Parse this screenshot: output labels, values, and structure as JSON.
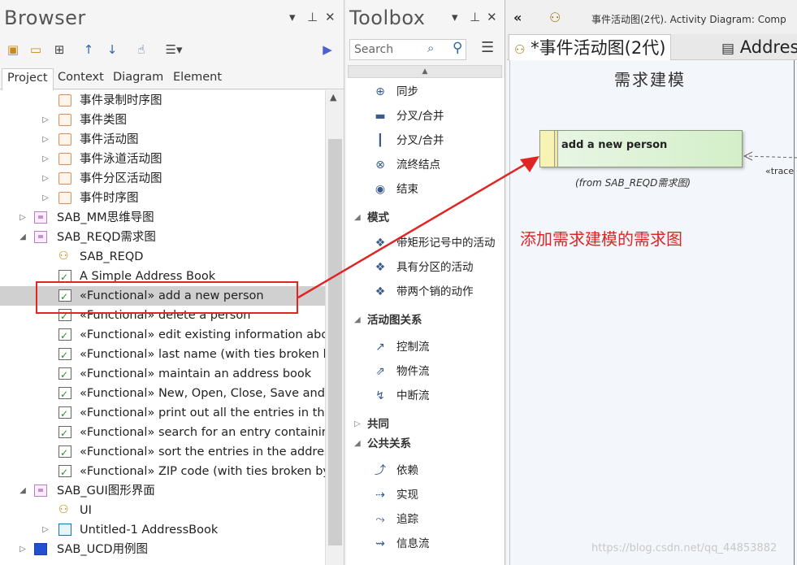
{
  "browser": {
    "title": "Browser",
    "tabs": [
      "Project",
      "Context",
      "Diagram",
      "Element"
    ],
    "tree": [
      {
        "label": "事件录制时序图",
        "icon": "folder-icon",
        "expander": ""
      },
      {
        "label": "事件类图",
        "icon": "folder-icon",
        "expander": "▷"
      },
      {
        "label": "事件活动图",
        "icon": "folder-icon",
        "expander": "▷"
      },
      {
        "label": "事件泳道活动图",
        "icon": "folder-icon",
        "expander": "▷"
      },
      {
        "label": "事件分区活动图",
        "icon": "folder-icon",
        "expander": "▷"
      },
      {
        "label": "事件时序图",
        "icon": "folder-icon",
        "expander": "▷"
      },
      {
        "label": "SAB_MM思维导图",
        "icon": "package-icon",
        "expander": "▷"
      },
      {
        "label": "SAB_REQD需求图",
        "icon": "package-icon",
        "expander": "◢"
      },
      {
        "label": "SAB_REQD",
        "icon": "hierarchy-icon",
        "expander": ""
      },
      {
        "label": "A Simple Address Book",
        "icon": "requirement-icon",
        "expander": ""
      },
      {
        "label": "«Functional» add a new person",
        "icon": "requirement-icon",
        "expander": ""
      },
      {
        "label": "«Functional» delete a person",
        "icon": "requirement-icon",
        "expander": ""
      },
      {
        "label": "«Functional» edit existing information abo",
        "icon": "requirement-icon",
        "expander": ""
      },
      {
        "label": "«Functional» last name (with ties broken b",
        "icon": "requirement-icon",
        "expander": ""
      },
      {
        "label": "«Functional» maintain an address book",
        "icon": "requirement-icon",
        "expander": ""
      },
      {
        "label": "«Functional» New, Open, Close, Save and",
        "icon": "requirement-icon",
        "expander": ""
      },
      {
        "label": "«Functional» print out all the entries in the",
        "icon": "requirement-icon",
        "expander": ""
      },
      {
        "label": "«Functional» search for an entry containin",
        "icon": "requirement-icon",
        "expander": ""
      },
      {
        "label": "«Functional» sort the entries in the addres",
        "icon": "requirement-icon",
        "expander": ""
      },
      {
        "label": "«Functional» ZIP code (with ties broken by",
        "icon": "requirement-icon",
        "expander": ""
      },
      {
        "label": "SAB_GUI图形界面",
        "icon": "package-icon",
        "expander": "◢"
      },
      {
        "label": "UI",
        "icon": "hierarchy-icon",
        "expander": ""
      },
      {
        "label": "Untitled-1 AddressBook",
        "icon": "document-icon",
        "expander": "▷"
      },
      {
        "label": "SAB_UCD用例图",
        "icon": "usecase-package-icon",
        "expander": "▷"
      }
    ]
  },
  "toolbox": {
    "title": "Toolbox",
    "search_placeholder": "Search",
    "items": [
      {
        "type": "item",
        "label": "同步",
        "icon": "sync-icon"
      },
      {
        "type": "item",
        "label": "分叉/合并",
        "icon": "fork-horizontal-icon"
      },
      {
        "type": "item",
        "label": "分叉/合并",
        "icon": "fork-vertical-icon"
      },
      {
        "type": "item",
        "label": "流终结点",
        "icon": "flow-final-icon"
      },
      {
        "type": "item",
        "label": "结束",
        "icon": "final-node-icon"
      },
      {
        "type": "group",
        "label": "模式",
        "expander": "◢"
      },
      {
        "type": "item",
        "label": "带矩形记号中的活动",
        "icon": "pattern-icon"
      },
      {
        "type": "item",
        "label": "具有分区的活动",
        "icon": "pattern-icon"
      },
      {
        "type": "item",
        "label": "带两个销的动作",
        "icon": "pattern-icon"
      },
      {
        "type": "group",
        "label": "活动图关系",
        "expander": "◢"
      },
      {
        "type": "item",
        "label": "控制流",
        "icon": "control-flow-icon"
      },
      {
        "type": "item",
        "label": "物件流",
        "icon": "object-flow-icon"
      },
      {
        "type": "item",
        "label": "中断流",
        "icon": "interrupt-flow-icon"
      },
      {
        "type": "group",
        "label": "共同",
        "expander": "▷"
      },
      {
        "type": "group",
        "label": "公共关系",
        "expander": "◢"
      },
      {
        "type": "item",
        "label": "依赖",
        "icon": "dependency-icon"
      },
      {
        "type": "item",
        "label": "实现",
        "icon": "realization-icon"
      },
      {
        "type": "item",
        "label": "追踪",
        "icon": "trace-icon"
      },
      {
        "type": "item",
        "label": "信息流",
        "icon": "information-flow-icon"
      }
    ]
  },
  "diagram": {
    "breadcrumb": "事件活动图(2代).  Activity Diagram: Comp",
    "tabs": [
      "*事件活动图(2代)",
      "Address"
    ],
    "heading": "需求建模",
    "element_name": "add a new person",
    "element_from": "(from SAB_REQD需求图)",
    "trace_label": "«trace"
  },
  "annotation": {
    "text": "添加需求建模的需求图",
    "color": "#e02525"
  },
  "watermark": "https://blog.csdn.net/qq_44853882"
}
